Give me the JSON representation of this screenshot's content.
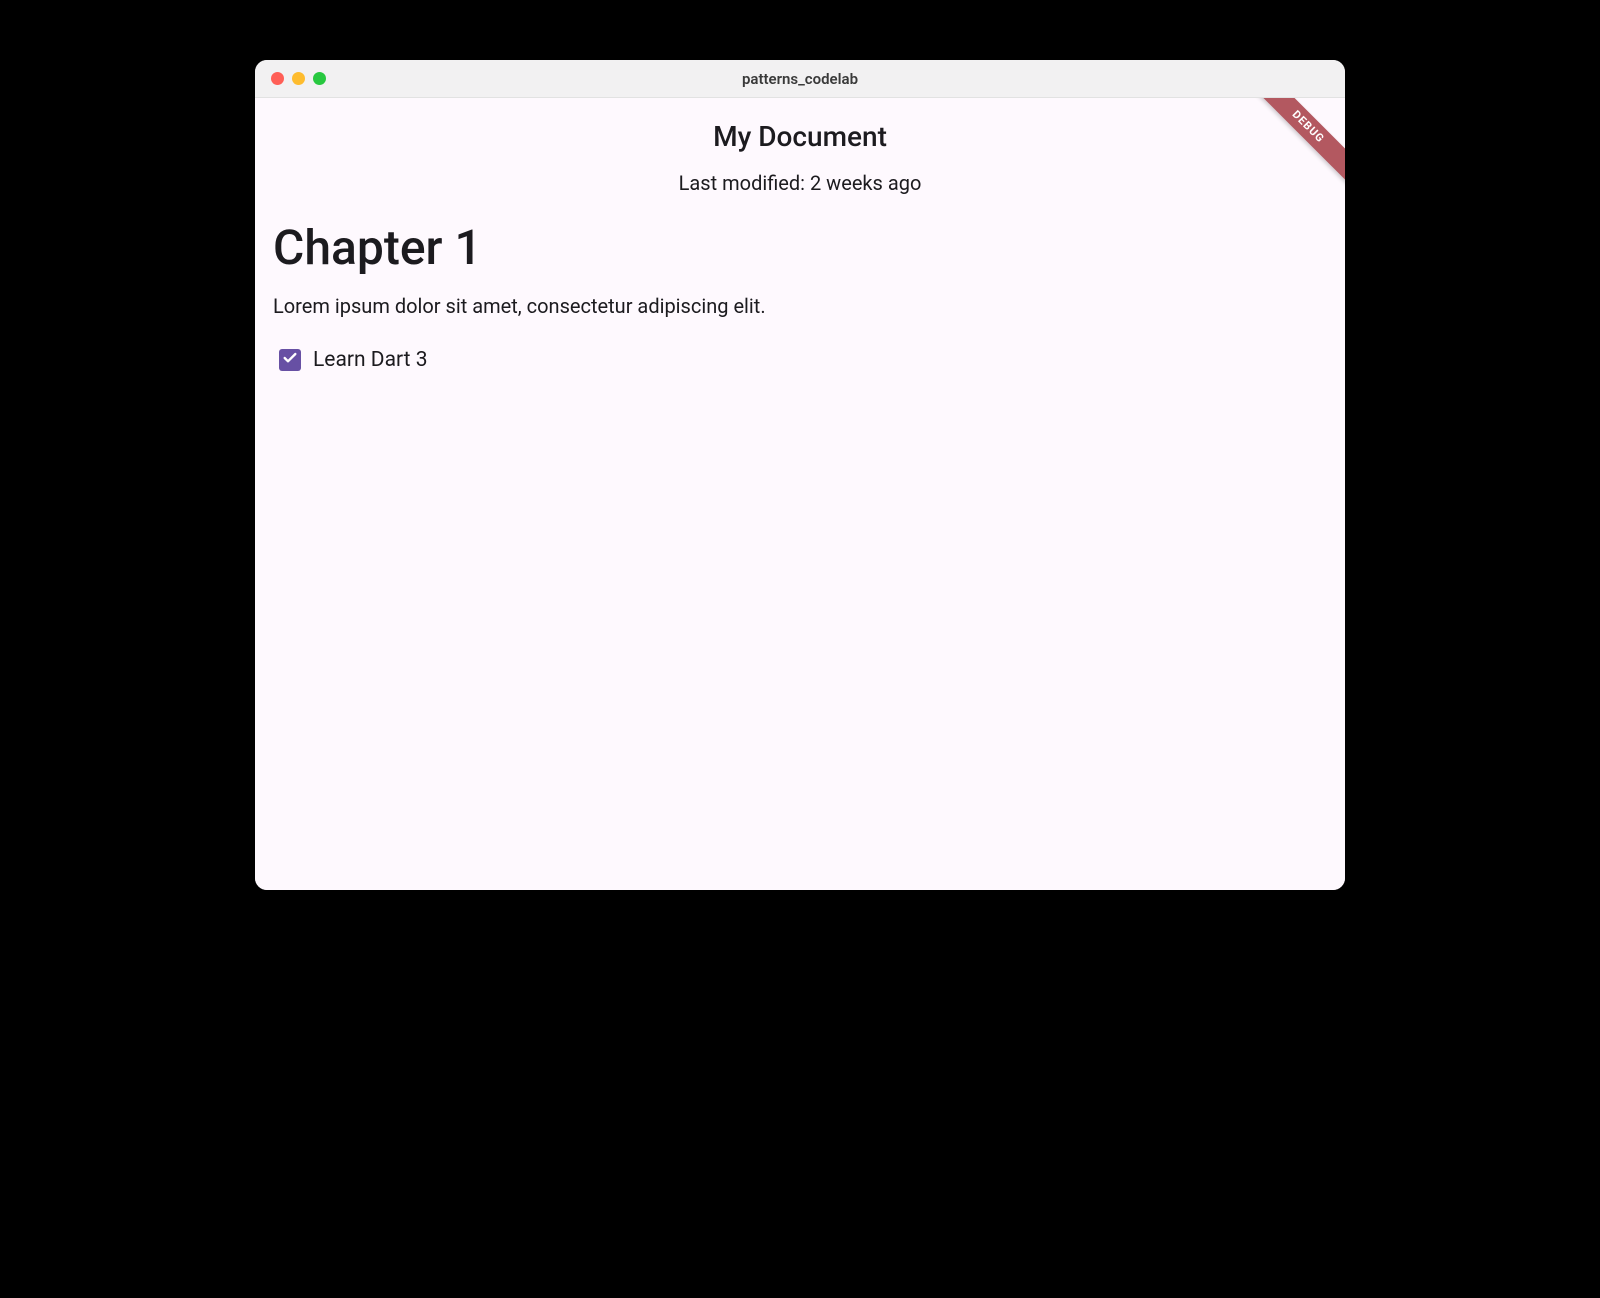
{
  "window": {
    "title": "patterns_codelab"
  },
  "debug_banner": {
    "label": "DEBUG"
  },
  "header": {
    "title": "My Document",
    "last_modified": "Last modified: 2 weeks ago"
  },
  "content": {
    "heading": "Chapter 1",
    "paragraph": "Lorem ipsum dolor sit amet, consectetur adipiscing elit."
  },
  "checkbox_item": {
    "label": "Learn Dart 3",
    "checked": true
  },
  "colors": {
    "primary": "#6750a4",
    "surface": "#fef9fe",
    "debug_banner": "#b35860"
  }
}
